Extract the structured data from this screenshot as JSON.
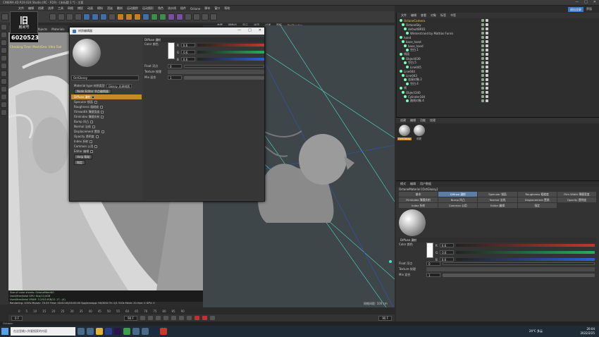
{
  "window": {
    "title": "CINEMA 4D R19.024 Studio (RC - R19) - [未标题 1 *] - 主要",
    "minimize": "—",
    "maximize": "□",
    "close": "✕"
  },
  "top_right": {
    "chip": "退出全屏",
    "widget_label": "界面"
  },
  "menu": [
    "文件",
    "编辑",
    "创建",
    "选择",
    "工具",
    "网格",
    "捕捉",
    "动画",
    "模拟",
    "渲染",
    "雕刻",
    "运动跟踪",
    "运动图形",
    "角色",
    "流水线",
    "插件",
    "Octane",
    "脚本",
    "窗口",
    "帮助"
  ],
  "logo": {
    "big": "旧",
    "small": "房间号",
    "number": "6020523"
  },
  "viewport1": {
    "tabs": [
      "Objects",
      "Materials"
    ],
    "info_text": "Checking Time: Mesh/Geo: Ultra Tool",
    "stat_lines": [
      "Size of color sheets: OctaneMemNO",
      "Used/free/total GPU: 6cp/11/4GB",
      "Used/free/total VRAM: 3.2/9/14GB/11.17...(4)",
      "Rendering: 100%   Ms/sec: 70.53   Time: 00:00:00/00:00:00   Spp/maxspp: 56/3000   Tri: 0/1 510k   Mesh: 20   Hair: 0   GPU: 0"
    ]
  },
  "viewport2": {
    "tabs": [
      "查看",
      "摄像机",
      "显示",
      "选项",
      "过滤",
      "面板",
      "ProRender"
    ],
    "scale": "网格间距: 100 cm"
  },
  "material_editor": {
    "title": "材质编辑器",
    "name": "OctGlossy",
    "type_label": "Material type 材质类型",
    "type_value": "Glossy 光泽材质",
    "node_button": "Node Editor 节点编辑器",
    "channels": [
      {
        "label": "Diffuse 漫射",
        "active": true
      },
      {
        "label": "Specular 镜面",
        "active": false
      },
      {
        "label": "Roughness 粗糙度",
        "active": false
      },
      {
        "label": "Filmwidth 薄膜宽度",
        "active": false
      },
      {
        "label": "FilmIndex 薄膜折射",
        "active": false
      },
      {
        "label": "Bump 凹凸",
        "active": false
      },
      {
        "label": "Normal 法线",
        "active": false
      },
      {
        "label": "Displacement 置换",
        "active": false
      },
      {
        "label": "Opacity 透明度",
        "active": false
      },
      {
        "label": "Index 折射",
        "active": false
      },
      {
        "label": "Common 公用",
        "active": false
      },
      {
        "label": "Editor 编辑",
        "active": false
      }
    ],
    "help_button": "Help 帮助",
    "assign_button": "指定",
    "section": "Diffuse 漫射",
    "color_label": "Color 颜色",
    "rgb": [
      "0.6",
      "0.6",
      "0.6"
    ],
    "rgb_labels": [
      "R",
      "G",
      "B"
    ],
    "float_label": "Float 浮点",
    "float_value": "0",
    "texture_label": "Texture 纹理",
    "mix_label": "Mix 混合",
    "mix_value": "1"
  },
  "object_manager": {
    "menu": [
      "文件",
      "编辑",
      "查看",
      "对象",
      "标签",
      "书签"
    ],
    "objects": [
      {
        "name": "OctaneCamera",
        "selected": true
      },
      {
        "name": "OctaneSky",
        "selected": false
      },
      {
        "name": "defaultBR01",
        "selected": false
      },
      {
        "name": "Winterstrand by Mattias Fornis",
        "selected": false
      },
      {
        "name": "hand",
        "selected": false
      },
      {
        "name": "base_hand",
        "selected": false
      },
      {
        "name": "base_hand",
        "selected": false
      },
      {
        "name": "空白.1",
        "selected": false
      },
      {
        "name": "线段",
        "selected": false
      },
      {
        "name": "Object039",
        "selected": false
      },
      {
        "name": "空白.5",
        "selected": false
      },
      {
        "name": "Line045",
        "selected": false
      },
      {
        "name": "Line044",
        "selected": false
      },
      {
        "name": "Line043",
        "selected": false
      },
      {
        "name": "连接对象.2",
        "selected": false
      },
      {
        "name": "空白.4",
        "selected": false
      },
      {
        "name": "线",
        "selected": false
      },
      {
        "name": "Object340",
        "selected": false
      },
      {
        "name": "Cylinder184",
        "selected": false
      },
      {
        "name": "曲线对象.4",
        "selected": false
      }
    ]
  },
  "material_manager": {
    "menu": [
      "创建",
      "编辑",
      "功能",
      "纹理"
    ],
    "balls": [
      "OctGlossy",
      "材质"
    ]
  },
  "attributes": {
    "menu": [
      "模式",
      "编辑",
      "用户数据"
    ],
    "title": "OctaneMaterial [OctGlossy]",
    "tabs": [
      {
        "label": "基本",
        "active": false
      },
      {
        "label": "Diffuse 漫射",
        "active": true
      },
      {
        "label": "Specular 镜面",
        "active": false
      },
      {
        "label": "Roughness 粗糙度",
        "active": false
      },
      {
        "label": "Film Width 薄膜宽度",
        "active": false
      },
      {
        "label": "FilmIndex 薄膜折射",
        "active": false
      },
      {
        "label": "Bump 凹凸",
        "active": false
      },
      {
        "label": "Normal 法线",
        "active": false
      },
      {
        "label": "Displacement 置换",
        "active": false
      },
      {
        "label": "Opacity 透明度",
        "active": false
      },
      {
        "label": "Index 折射",
        "active": false
      },
      {
        "label": "Common 公用",
        "active": false
      },
      {
        "label": "Editor 编辑",
        "active": false
      },
      {
        "label": "指定",
        "active": false
      }
    ],
    "section": "Diffuse 漫射",
    "color_label": "Color 颜色",
    "rgb": [
      "0.6",
      "0.6",
      "0.6"
    ],
    "rgb_labels": [
      "R",
      "G",
      "B"
    ],
    "float_label": "Float 浮点",
    "float_value": "0",
    "texture_label": "Texture 纹理",
    "mix_label": "Mix 混合",
    "mix_value": "1"
  },
  "timeline": {
    "ticks": [
      "0",
      "5",
      "10",
      "15",
      "20",
      "25",
      "30",
      "35",
      "40",
      "45",
      "50",
      "55",
      "60",
      "65",
      "70",
      "75",
      "80",
      "85",
      "90"
    ],
    "frame_start": "0 F",
    "frame_end": "90 F",
    "end_frame": "90 F"
  },
  "status": "Octane:",
  "taskbar": {
    "search_placeholder": "在这里输入你要搜索的内容",
    "weather": "24°C 多云",
    "time": "20:04",
    "date": "2022/2/25"
  },
  "colors": {
    "accent": "#f3c34b",
    "active_channel": "#c58a2a",
    "active_tab": "#5c7ea3",
    "slider_r": "#c0392b",
    "slider_g": "#27ae60",
    "slider_b": "#2c5fd6"
  }
}
